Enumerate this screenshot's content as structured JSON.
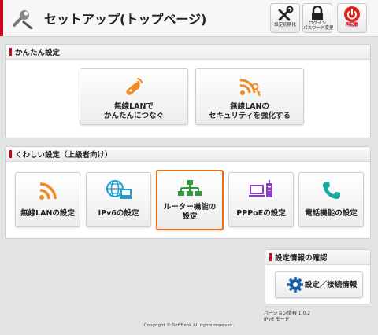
{
  "header": {
    "title": "セットアップ(トップページ)",
    "buttons": [
      {
        "label": "設定初期化",
        "icon": "tools-icon"
      },
      {
        "label_line1": "ログイン",
        "label_line2": "パスワード変更",
        "icon": "lock-icon"
      },
      {
        "label": "再起動",
        "icon": "power-icon"
      }
    ]
  },
  "easy": {
    "title": "かんたん設定",
    "tiles": [
      {
        "label": "無線LANで\nかんたんにつなぐ",
        "icon": "wireless-key-icon"
      },
      {
        "label": "無線LANの\nセキュリティを強化する",
        "icon": "wifi-key-icon"
      }
    ]
  },
  "advanced": {
    "title": "くわしい設定（上級者向け）",
    "tiles": [
      {
        "label": "無線LANの設定",
        "icon": "wifi-icon"
      },
      {
        "label": "IPv6の設定",
        "icon": "globe-monitor-icon"
      },
      {
        "label": "ルーター機能の\n設定",
        "icon": "network-tree-icon"
      },
      {
        "label": "PPPoEの設定",
        "icon": "pppoe-device-icon"
      },
      {
        "label": "電話機能の設定",
        "icon": "phone-icon"
      }
    ]
  },
  "info": {
    "title": "設定情報の確認",
    "button": "設定／接続情報",
    "version": "バージョン情報 1.0.2",
    "mode": "IPv6 モード"
  },
  "footer": {
    "copyright": "Copyright © SoftBank All rights reserved."
  },
  "colors": {
    "accent": "#d0021b",
    "orange": "#f08a24",
    "blue": "#1aa0d8",
    "green": "#2f9b3d",
    "purple": "#8a3fbf",
    "teal": "#1aa9a0"
  }
}
